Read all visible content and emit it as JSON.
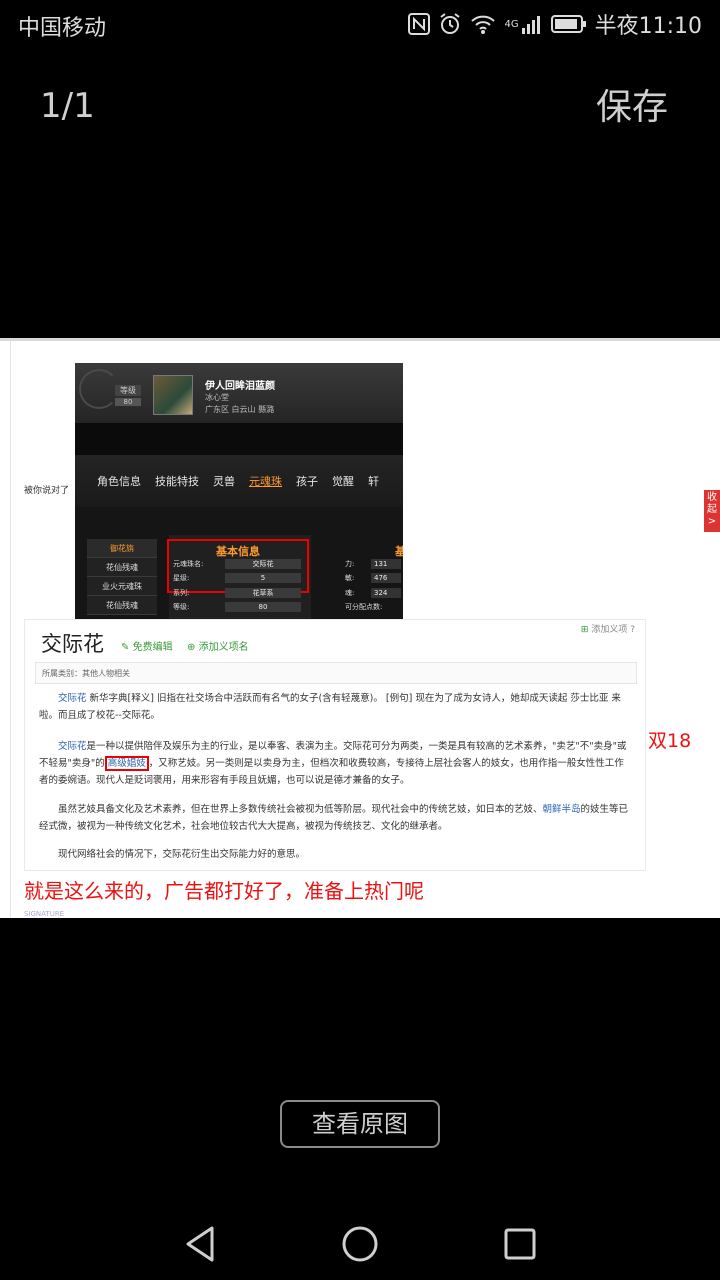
{
  "status_bar": {
    "carrier": "中国移动",
    "network": "4G",
    "time": "半夜11:10"
  },
  "viewer": {
    "page_counter": "1/1",
    "save_label": "保存",
    "view_original_label": "查看原图"
  },
  "image": {
    "side_caption": "被你说对了",
    "game": {
      "level_label": "等级",
      "level_value": "80",
      "char_name": "伊人回眸泪蓝颜",
      "char_sub1": "冰心堂",
      "char_sub2": "广东区 白云山 縣潞",
      "tabs": [
        "角色信息",
        "技能特技",
        "灵兽",
        "元魂珠",
        "孩子",
        "觉醒",
        "轩"
      ],
      "active_tab": "元魂珠",
      "sidebar": [
        "御花旃",
        "花仙残魂",
        "业火元魂珠",
        "花仙残魂"
      ],
      "panel_title": "基本信息",
      "right_head": "基",
      "info_rows": [
        {
          "label": "元魂珠名:",
          "value": "交际花"
        },
        {
          "label": "星级:",
          "value": "5"
        },
        {
          "label": "系列:",
          "value": "花草系"
        },
        {
          "label": "等级:",
          "value": "80"
        }
      ],
      "stats": [
        {
          "label": "力:",
          "value": "131"
        },
        {
          "label": "敏:",
          "value": "476"
        },
        {
          "label": "魂:",
          "value": "324"
        },
        {
          "label": "可分配点数:",
          "value": ""
        }
      ]
    },
    "baike": {
      "title": "交际花",
      "edit_link": "免费编辑",
      "add_name_link": "添加义项名",
      "add_term_link": "添加义项",
      "category": "所属类别：其他人物相关",
      "p1_term": "交际花",
      "p1_text": " 新华字典[释义] 旧指在社交场合中活跃而有名气的女子(含有轻蔑意)。 [例句] 现在为了成为女诗人，她却成天读起 莎士比亚 来啦。而且成了校花--交际花。",
      "p2_term": "交际花",
      "p2_text_a": "是一种以提供陪伴及娱乐为主的行业，是以奉客、表演为主。交际花可分为两类，一类是具有较高的艺术素养，\"卖艺\"不\"卖身\"或不轻易\"卖身\"的",
      "p2_highlight": "高级娼妓",
      "p2_text_b": "，又称艺妓。另一类则是以卖身为主，但档次和收费较高，专接待上层社会客人的妓女，也用作指一般女性性工作者的委婉语。现代人是贬词褒用，用来形容有手段且妩媚，也可以说是德才兼备的女子。",
      "p3_text_a": "虽然艺妓具备文化及艺术素养，但在世界上多数传统社会被视为低等阶层。现代社会中的传统艺妓，如日本的艺妓、",
      "p3_link": "朝鲜半岛",
      "p3_text_b": "的妓生等已经式微，被视为一种传统文化艺术，社会地位较古代大大提高，被视为传统技艺、文化的继承者。",
      "p4_text": "现代网络社会的情况下，交际花衍生出交际能力好的意思。"
    },
    "side_red": "双18",
    "caption_red": "就是这么来的，广告都打好了，准备上热门呢",
    "tiny_footer": "SIGNATURE",
    "collapse_tab": "收起>"
  },
  "colors": {
    "background": "#000000",
    "red_text": "#e11111",
    "game_accent": "#ff9a2e",
    "link_blue": "#2d64b3"
  }
}
